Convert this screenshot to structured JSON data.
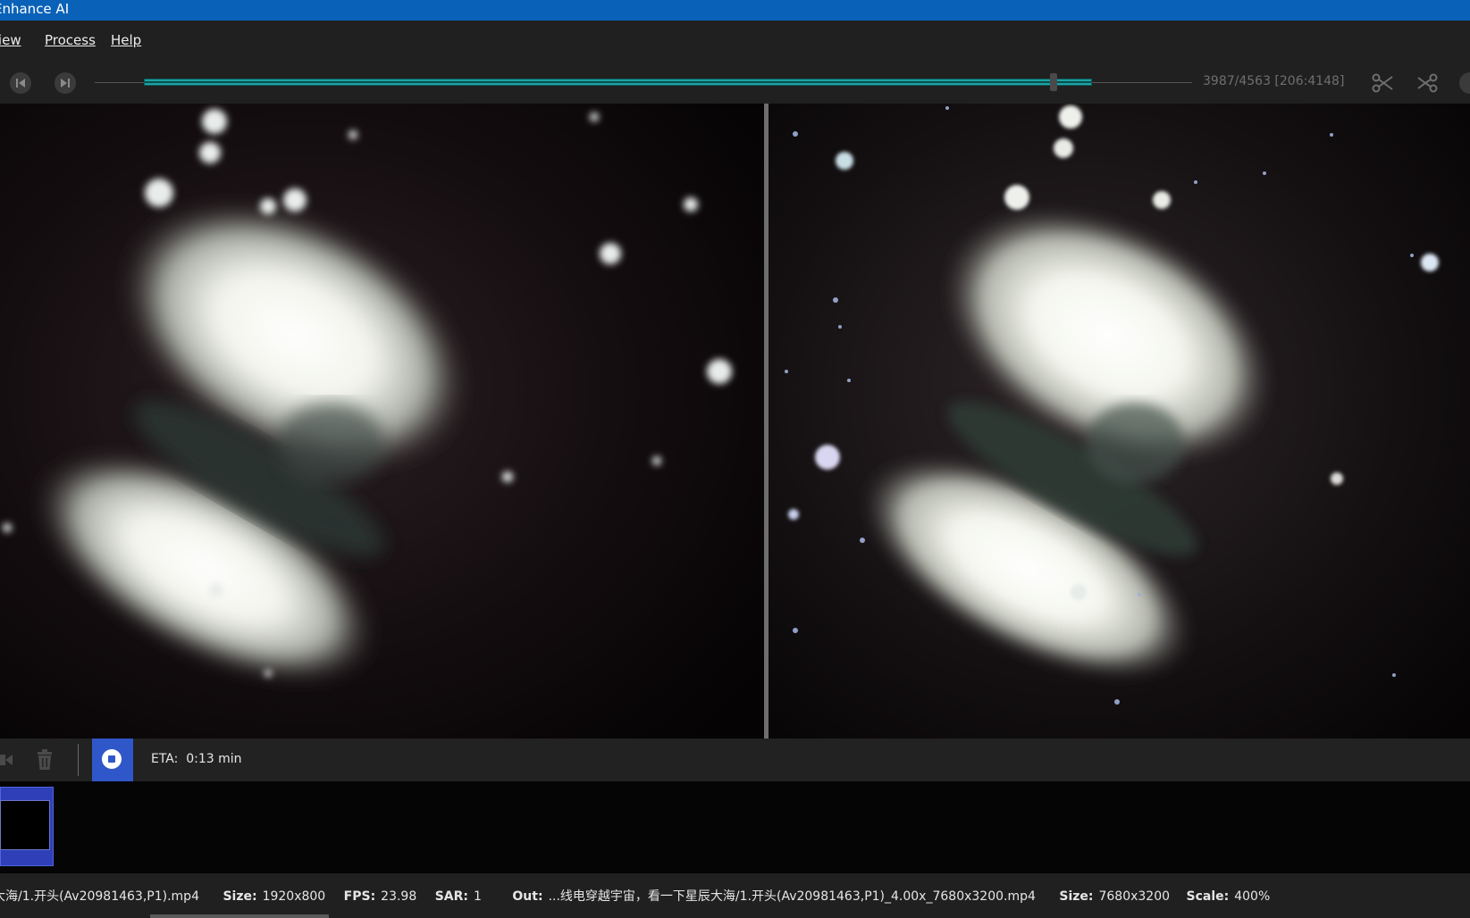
{
  "window": {
    "title": "Enhance AI"
  },
  "menu": [
    {
      "label": "View"
    },
    {
      "label": "Process"
    },
    {
      "label": "Help"
    }
  ],
  "timeline": {
    "frame_counter": "3987/4563  [206:4148]",
    "selection_start_frame": 206,
    "selection_end_frame": 4148,
    "current_frame": 3987,
    "total_frames": 4563
  },
  "controls": {
    "eta_label": "ETA:",
    "eta_value": "0:13 min"
  },
  "status": {
    "input_path": "大海/1.开头(Av20981463,P1).mp4",
    "input_size_label": "Size:",
    "input_size_value": "1920x800",
    "fps_label": "FPS:",
    "fps_value": "23.98",
    "sar_label": "SAR:",
    "sar_value": "1",
    "out_label": "Out:",
    "out_path": "...线电穿越宇宙，看一下星辰大海/1.开头(Av20981463,P1)_4.00x_7680x3200.mp4",
    "output_size_label": "Size:",
    "output_size_value": "7680x3200",
    "scale_label": "Scale:",
    "scale_value": "400%"
  },
  "icons": {
    "prev": "skip-back-icon",
    "next": "skip-forward-icon",
    "cut": "scissors-icon",
    "split": "split-icon",
    "delete": "trash-icon",
    "stop": "stop-icon"
  },
  "colors": {
    "titlebar": "#0a62b8",
    "timeline_range": "#1aa3a3",
    "stop_button": "#2f57c9"
  }
}
